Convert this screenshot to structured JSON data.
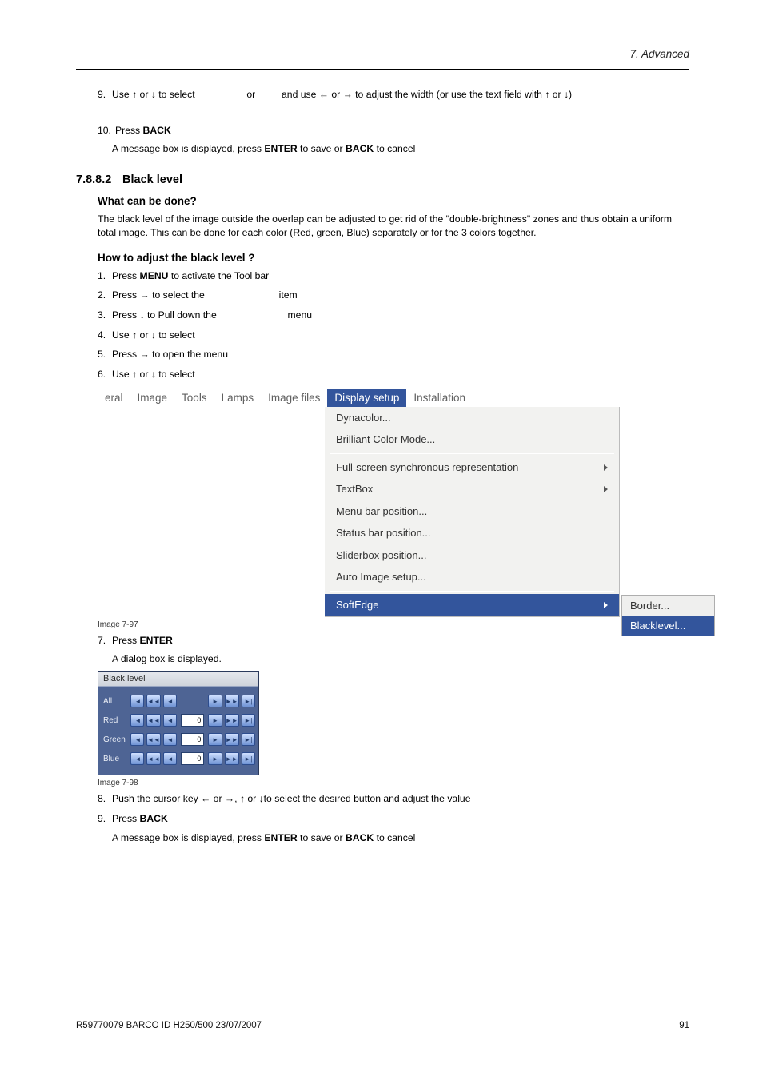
{
  "header": {
    "section_title": "7. Advanced"
  },
  "top_steps": {
    "s9": {
      "num": "9.",
      "pre": "Use ↑ or ↓ to select ",
      "mid": " or ",
      "post": " and use ← or → to adjust the width (or use the text field with ↑ or ↓)"
    },
    "s10": {
      "num": "10.",
      "text_a": "Press ",
      "back": "BACK",
      "sub_a": "A message box is displayed, press ",
      "enter": "ENTER",
      "sub_mid": " to save or ",
      "back2": "BACK",
      "sub_end": " to cancel"
    }
  },
  "section": {
    "num": "7.8.8.2",
    "title": "Black level"
  },
  "what": {
    "heading": "What can be done?",
    "para": "The black level of the image outside the overlap can be adjusted to get rid of the \"double-brightness\" zones and thus obtain a uniform total image. This can be done for each color (Red, green, Blue) separately or for the 3 colors together."
  },
  "how": {
    "heading": "How to adjust the black level ?",
    "steps": {
      "s1": {
        "num": "1.",
        "a": "Press ",
        "b": "MENU",
        "c": " to activate the Tool bar"
      },
      "s2": {
        "num": "2.",
        "a": "Press → to select the ",
        "c": " item"
      },
      "s3": {
        "num": "3.",
        "a": "Press ↓ to Pull down the ",
        "c": " menu"
      },
      "s4": {
        "num": "4.",
        "a": "Use ↑ or ↓ to select "
      },
      "s5": {
        "num": "5.",
        "a": "Press → to open the menu"
      },
      "s6": {
        "num": "6.",
        "a": "Use ↑ or ↓ to select "
      }
    }
  },
  "menu": {
    "bar": [
      "eral",
      "Image",
      "Tools",
      "Lamps",
      "Image files",
      "Display setup",
      "Installation"
    ],
    "active_index": 5,
    "dropdown": {
      "items": [
        {
          "label": "Dynacolor..."
        },
        {
          "label": "Brilliant Color Mode..."
        }
      ],
      "items2": [
        {
          "label": "Full-screen synchronous representation",
          "arrow": true
        },
        {
          "label": "TextBox",
          "arrow": true
        },
        {
          "label": "Menu bar position..."
        },
        {
          "label": "Status bar position..."
        },
        {
          "label": "Sliderbox position..."
        },
        {
          "label": "Auto Image setup..."
        }
      ],
      "highlight": {
        "label": "SoftEdge",
        "arrow": true
      }
    },
    "submenu": [
      {
        "label": "Border..."
      },
      {
        "label": "Blacklevel..."
      }
    ],
    "caption": "Image 7-97"
  },
  "after_menu": {
    "s7": {
      "num": "7.",
      "a": "Press ",
      "b": "ENTER",
      "sub": "A dialog box is displayed."
    }
  },
  "dialog": {
    "title": "Black level",
    "rows": [
      {
        "label": "All",
        "value": null
      },
      {
        "label": "Red",
        "value": "0"
      },
      {
        "label": "Green",
        "value": "0"
      },
      {
        "label": "Blue",
        "value": "0"
      }
    ],
    "btn_glyphs": {
      "first": "|◄",
      "rew": "◄◄",
      "prev": "◄",
      "next": "►",
      "fwd": "►►",
      "last": "►|"
    },
    "caption": "Image 7-98"
  },
  "final_steps": {
    "s8": {
      "num": "8.",
      "text": "Push the cursor key ← or →, ↑ or ↓to select the desired button and adjust the value"
    },
    "s9": {
      "num": "9.",
      "a": "Press ",
      "b": "BACK",
      "sub_a": "A message box is displayed, press ",
      "enter": "ENTER",
      "sub_mid": " to save or ",
      "back": "BACK",
      "sub_end": " to cancel"
    }
  },
  "footer": {
    "left": "R59770079  BARCO ID H250/500  23/07/2007",
    "page": "91"
  }
}
